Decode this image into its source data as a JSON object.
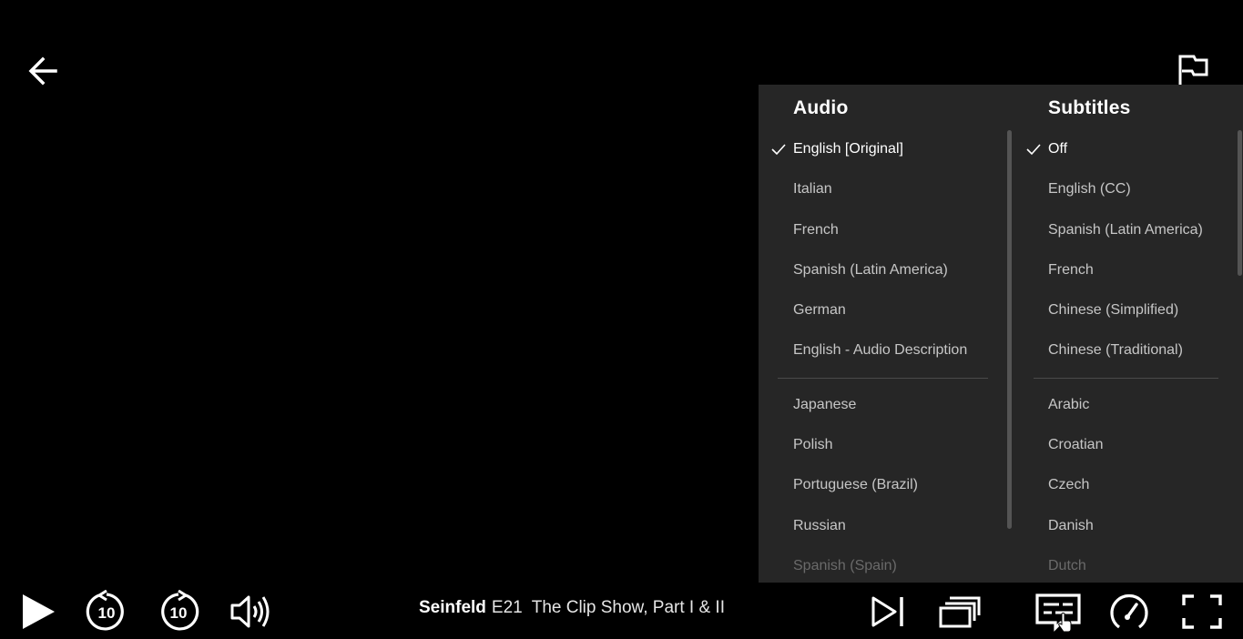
{
  "top": {
    "back_icon": "arrow-left-icon",
    "report_icon": "flag-icon"
  },
  "panel": {
    "audio_title": "Audio",
    "subtitles_title": "Subtitles",
    "audio_primary": [
      {
        "label": "English [Original]",
        "selected": true
      },
      {
        "label": "Italian"
      },
      {
        "label": "French"
      },
      {
        "label": "Spanish (Latin America)"
      },
      {
        "label": "German"
      },
      {
        "label": "English - Audio Description"
      }
    ],
    "audio_more": [
      {
        "label": "Japanese"
      },
      {
        "label": "Polish"
      },
      {
        "label": "Portuguese (Brazil)"
      },
      {
        "label": "Russian"
      },
      {
        "label": "Spanish (Spain)"
      }
    ],
    "subtitles_primary": [
      {
        "label": "Off",
        "selected": true
      },
      {
        "label": "English (CC)"
      },
      {
        "label": "Spanish (Latin America)"
      },
      {
        "label": "French"
      },
      {
        "label": "Chinese (Simplified)"
      },
      {
        "label": "Chinese (Traditional)"
      }
    ],
    "subtitles_more": [
      {
        "label": "Arabic"
      },
      {
        "label": "Croatian"
      },
      {
        "label": "Czech"
      },
      {
        "label": "Danish"
      },
      {
        "label": "Dutch"
      }
    ]
  },
  "player": {
    "show_title": "Seinfeld",
    "episode_number": "E21",
    "episode_title": "The Clip Show, Part I & II",
    "rewind_seconds": "10",
    "forward_seconds": "10"
  },
  "colors": {
    "background": "#000000",
    "panel_background": "#262626",
    "text_selected": "#ffffff",
    "text_normal": "#c6c6c6"
  }
}
